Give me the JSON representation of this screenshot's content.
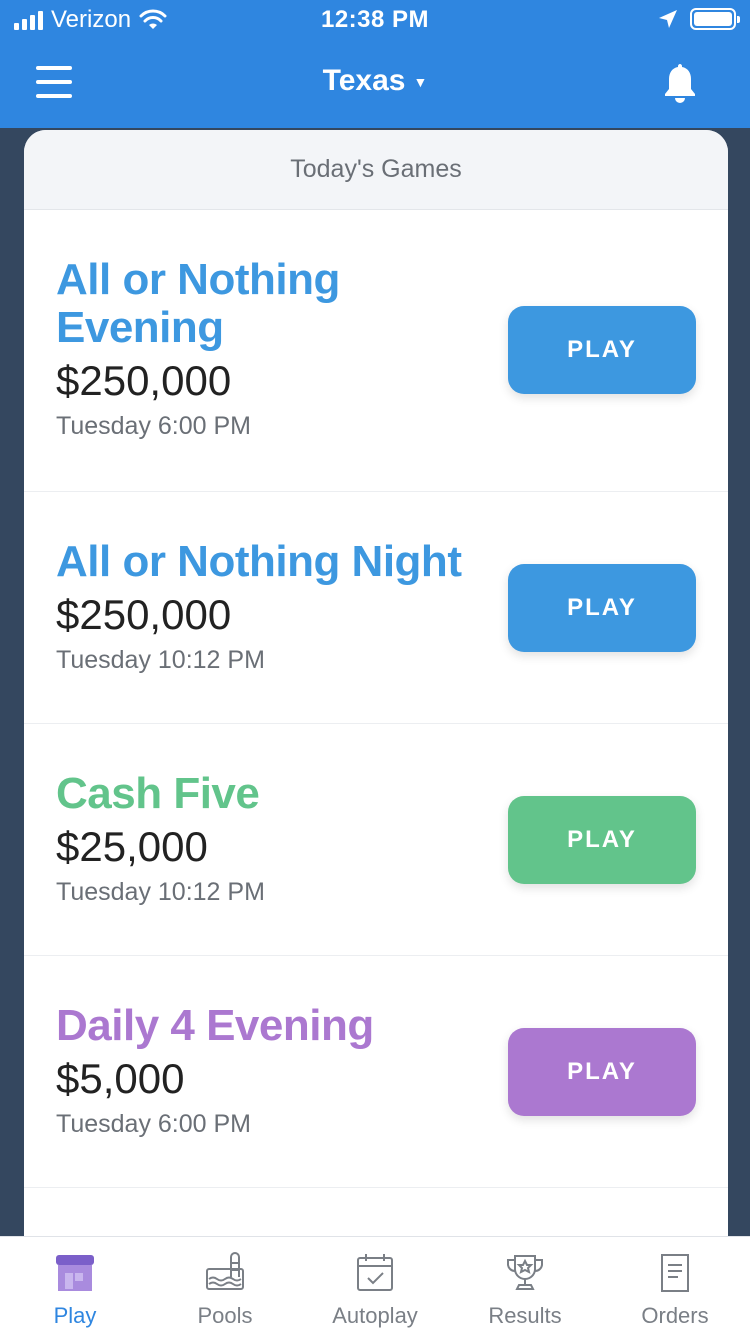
{
  "status_bar": {
    "carrier": "Verizon",
    "time": "12:38 PM"
  },
  "header": {
    "title": "Texas"
  },
  "card": {
    "title": "Today's Games"
  },
  "games": [
    {
      "name": "All or Nothing Evening",
      "name_line1": "All or Nothing",
      "name_line2": "Evening",
      "amount": "$250,000",
      "time": "Tuesday 6:00 PM",
      "button": "PLAY",
      "color": "#3d98e0"
    },
    {
      "name": "All or Nothing Night",
      "amount": "$250,000",
      "time": "Tuesday 10:12 PM",
      "button": "PLAY",
      "color": "#3d98e0"
    },
    {
      "name": "Cash Five",
      "amount": "$25,000",
      "time": "Tuesday 10:12 PM",
      "button": "PLAY",
      "color": "#62c48b"
    },
    {
      "name": "Daily 4 Evening",
      "amount": "$5,000",
      "time": "Tuesday 6:00 PM",
      "button": "PLAY",
      "color": "#ab78d0"
    }
  ],
  "tabs": [
    {
      "label": "Play",
      "icon": "store-icon",
      "active": true
    },
    {
      "label": "Pools",
      "icon": "pool-icon",
      "active": false
    },
    {
      "label": "Autoplay",
      "icon": "calendar-check-icon",
      "active": false
    },
    {
      "label": "Results",
      "icon": "trophy-icon",
      "active": false
    },
    {
      "label": "Orders",
      "icon": "receipt-icon",
      "active": false
    }
  ],
  "colors": {
    "brand_blue": "#2f86e0",
    "background": "#34475f",
    "blue_game": "#3d98e0",
    "green_game": "#62c48b",
    "purple_game": "#ab78d0"
  }
}
